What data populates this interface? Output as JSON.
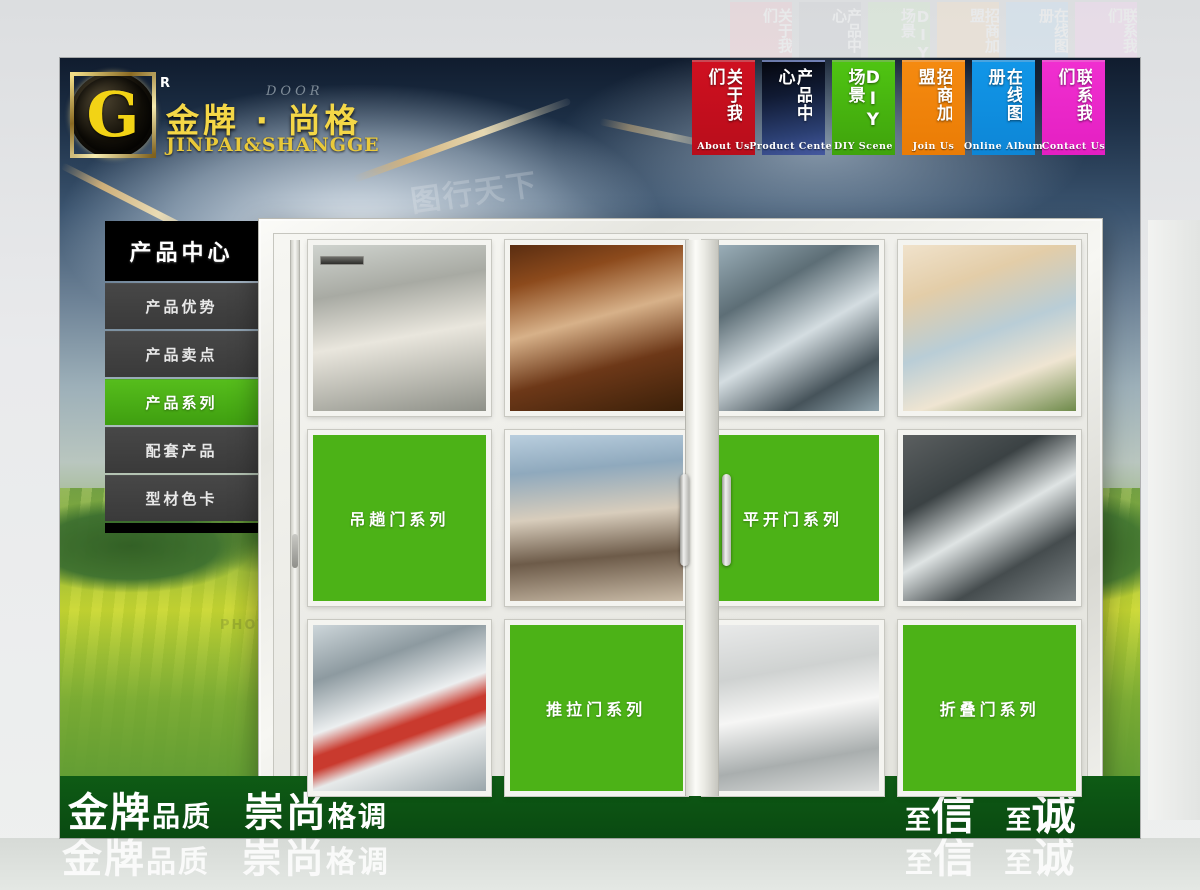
{
  "brand": {
    "logo_letter": "G",
    "registered_mark": "R",
    "door_word": "DOOR",
    "name_cn": "金牌 · 尚格",
    "name_en": "JINPAI&SHANGGE"
  },
  "topnav": {
    "items": [
      {
        "cn": "关于我们",
        "en": "About  Us",
        "color": "#cf1020"
      },
      {
        "cn": "产品中心",
        "en": "Product Center",
        "color": "#2b3f72"
      },
      {
        "cn": "DIY场景",
        "en": "DIY  Scene",
        "color": "#4fc412"
      },
      {
        "cn": "招商加盟",
        "en": "Join    Us",
        "color": "#f58a10"
      },
      {
        "cn": "在线图册",
        "en": "Online Album",
        "color": "#1196e8"
      },
      {
        "cn": "联系我们",
        "en": "Contact Us",
        "color": "#f02fd0"
      }
    ]
  },
  "sidebar": {
    "title": "产品中心",
    "items": [
      {
        "label": "产品优势",
        "active": false
      },
      {
        "label": "产品卖点",
        "active": false
      },
      {
        "label": "产品系列",
        "active": true
      },
      {
        "label": "配套产品",
        "active": false
      },
      {
        "label": "型材色卡",
        "active": false
      }
    ],
    "active_color": "#4cb217"
  },
  "grid": {
    "cells": [
      {
        "type": "photo",
        "name": "sunroom-lounge-photo"
      },
      {
        "type": "photo",
        "name": "wooden-door-photo"
      },
      {
        "type": "photo",
        "name": "aluminium-window-photo"
      },
      {
        "type": "photo",
        "name": "curtain-living-room-photo"
      },
      {
        "type": "green",
        "label": "吊趟门系列"
      },
      {
        "type": "photo",
        "name": "rooftop-terrace-photo"
      },
      {
        "type": "green",
        "label": "平开门系列"
      },
      {
        "type": "photo",
        "name": "grey-frame-corner-photo"
      },
      {
        "type": "photo",
        "name": "balcony-red-chair-photo"
      },
      {
        "type": "green",
        "label": "推拉门系列"
      },
      {
        "type": "photo",
        "name": "white-interior-doors-photo"
      },
      {
        "type": "green",
        "label": "折叠门系列"
      }
    ]
  },
  "banner": {
    "left_1": "金牌",
    "left_2": "品质",
    "left_3": "崇尚",
    "left_4": "格调",
    "right_1": "至",
    "right_2": "信",
    "right_3": "至",
    "right_4": "诚",
    "background": "#0a4a11"
  },
  "watermarks": {
    "site": "PHOTO.CN",
    "site_alt": "图行天下"
  }
}
